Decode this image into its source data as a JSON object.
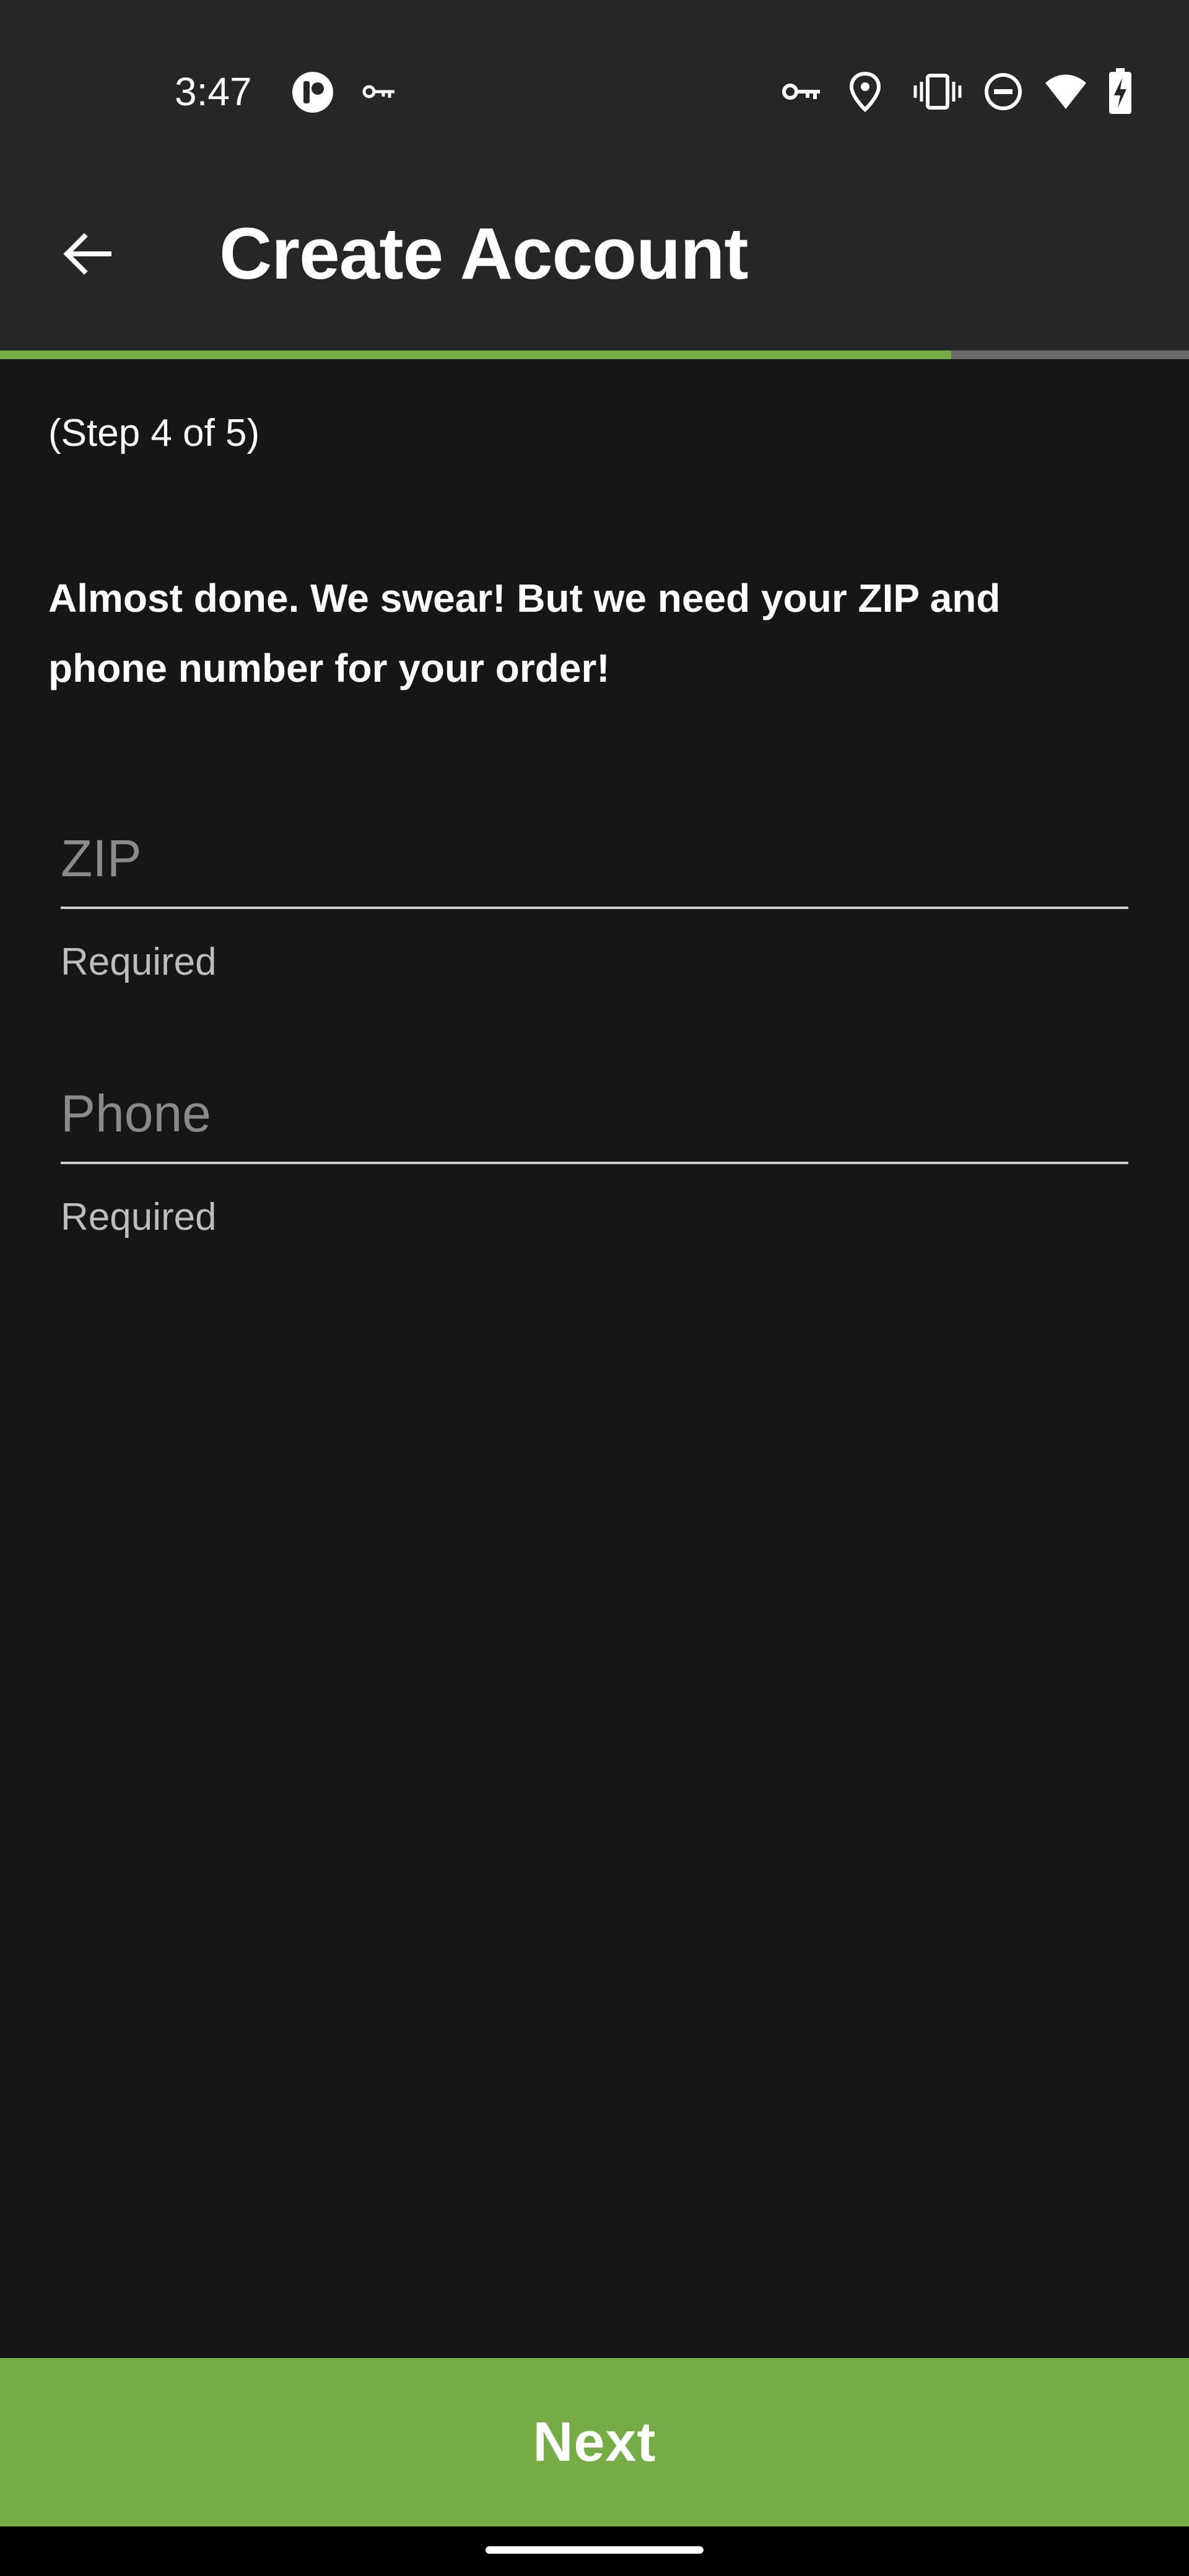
{
  "status_bar": {
    "time": "3:47",
    "left_icons": [
      "app-notification-icon",
      "vpn-key-icon"
    ],
    "right_icons": [
      "vpn-key-icon",
      "location-icon",
      "vibrate-icon",
      "do-not-disturb-icon",
      "wifi-icon",
      "battery-charging-icon"
    ]
  },
  "app_bar": {
    "title": "Create Account",
    "back_icon": "arrow-back-icon"
  },
  "progress": {
    "step": 4,
    "total": 5,
    "fraction": 0.8,
    "fill_color": "#74ad45",
    "track_color": "#6b6b6b"
  },
  "form": {
    "step_label": "(Step 4 of 5)",
    "intro": "Almost done. We swear! But we need your ZIP and phone number for your order!",
    "zip": {
      "value": "",
      "placeholder": "ZIP",
      "helper": "Required"
    },
    "phone": {
      "value": "",
      "placeholder": "Phone",
      "helper": "Required"
    }
  },
  "footer": {
    "next_label": "Next",
    "button_color": "#74ad45"
  }
}
